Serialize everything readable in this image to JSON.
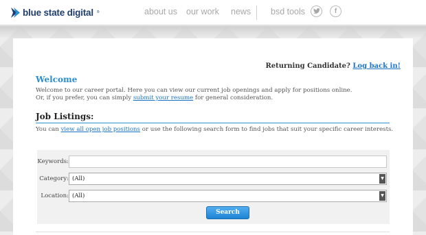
{
  "header": {
    "logo_text": "blue state digital",
    "logo_mark": "registered",
    "nav": [
      "about us",
      "our work",
      "news",
      "bsd tools"
    ],
    "social_icons": [
      "twitter-icon",
      "facebook-icon"
    ],
    "social_glyphs": [
      "t",
      "f"
    ]
  },
  "returning": {
    "prefix": "Returning Candidate?",
    "link": "Log back in!"
  },
  "welcome": {
    "title": "Welcome",
    "line1": "Welcome to our career portal. Here you can view our current job openings and apply for positions online.",
    "line2_prefix": "Or, if you prefer, you can simply",
    "line2_link": "submit your resume",
    "line2_suffix": "for general consideration."
  },
  "jobs": {
    "title": "Job Listings:",
    "text_prefix": "You can",
    "text_link": "view all open job positions",
    "text_suffix": "or use the following search form to find jobs that suit your specific career interests."
  },
  "form": {
    "keywords_label": "Keywords:",
    "keywords_value": "",
    "category_label": "Category:",
    "category_value": "(All)",
    "location_label": "Location:",
    "location_value": "(All)",
    "search_label": "Search"
  },
  "colors": {
    "brand": "#1f3e6e",
    "accent": "#2a8ed1",
    "link": "#1a73c4",
    "nav_text": "#a8a8a8"
  }
}
